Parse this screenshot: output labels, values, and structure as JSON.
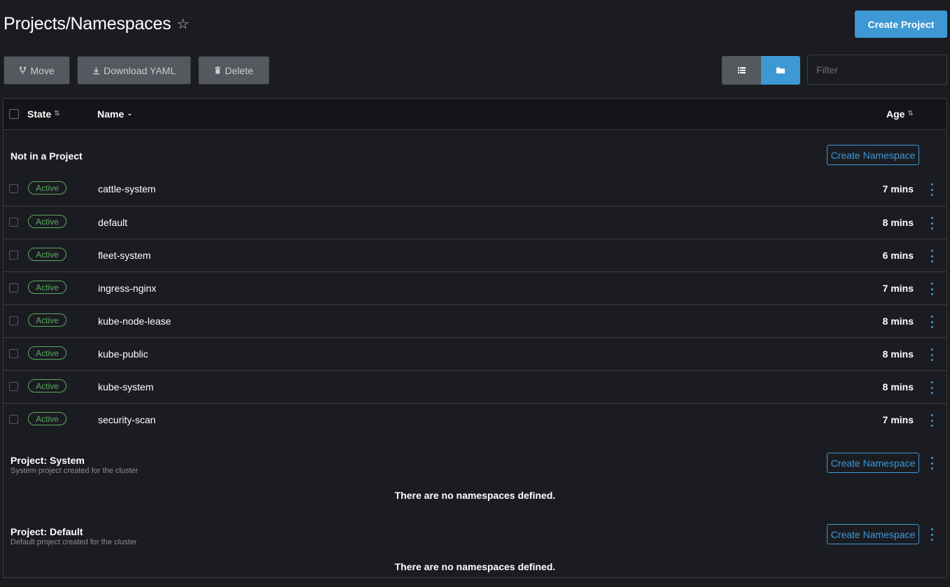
{
  "header": {
    "title": "Projects/Namespaces",
    "create_project_label": "Create Project"
  },
  "toolbar": {
    "move_label": "Move",
    "download_label": "Download YAML",
    "delete_label": "Delete",
    "filter_placeholder": "Filter"
  },
  "table": {
    "columns": {
      "state": "State",
      "name": "Name",
      "age": "Age"
    },
    "groups": [
      {
        "title": "Not in a Project",
        "description": "",
        "create_label": "Create Namespace",
        "rows": [
          {
            "state": "Active",
            "name": "cattle-system",
            "age": "7 mins"
          },
          {
            "state": "Active",
            "name": "default",
            "age": "8 mins"
          },
          {
            "state": "Active",
            "name": "fleet-system",
            "age": "6 mins"
          },
          {
            "state": "Active",
            "name": "ingress-nginx",
            "age": "7 mins"
          },
          {
            "state": "Active",
            "name": "kube-node-lease",
            "age": "8 mins"
          },
          {
            "state": "Active",
            "name": "kube-public",
            "age": "8 mins"
          },
          {
            "state": "Active",
            "name": "kube-system",
            "age": "8 mins"
          },
          {
            "state": "Active",
            "name": "security-scan",
            "age": "7 mins"
          }
        ]
      },
      {
        "title": "Project: System",
        "description": "System project created for the cluster",
        "create_label": "Create Namespace",
        "empty_message": "There are no namespaces defined."
      },
      {
        "title": "Project: Default",
        "description": "Default project created for the cluster",
        "create_label": "Create Namespace",
        "empty_message": "There are no namespaces defined."
      }
    ]
  },
  "colors": {
    "accent": "#3d98d3",
    "active_badge": "#5aa961",
    "background": "#1b1c21"
  }
}
